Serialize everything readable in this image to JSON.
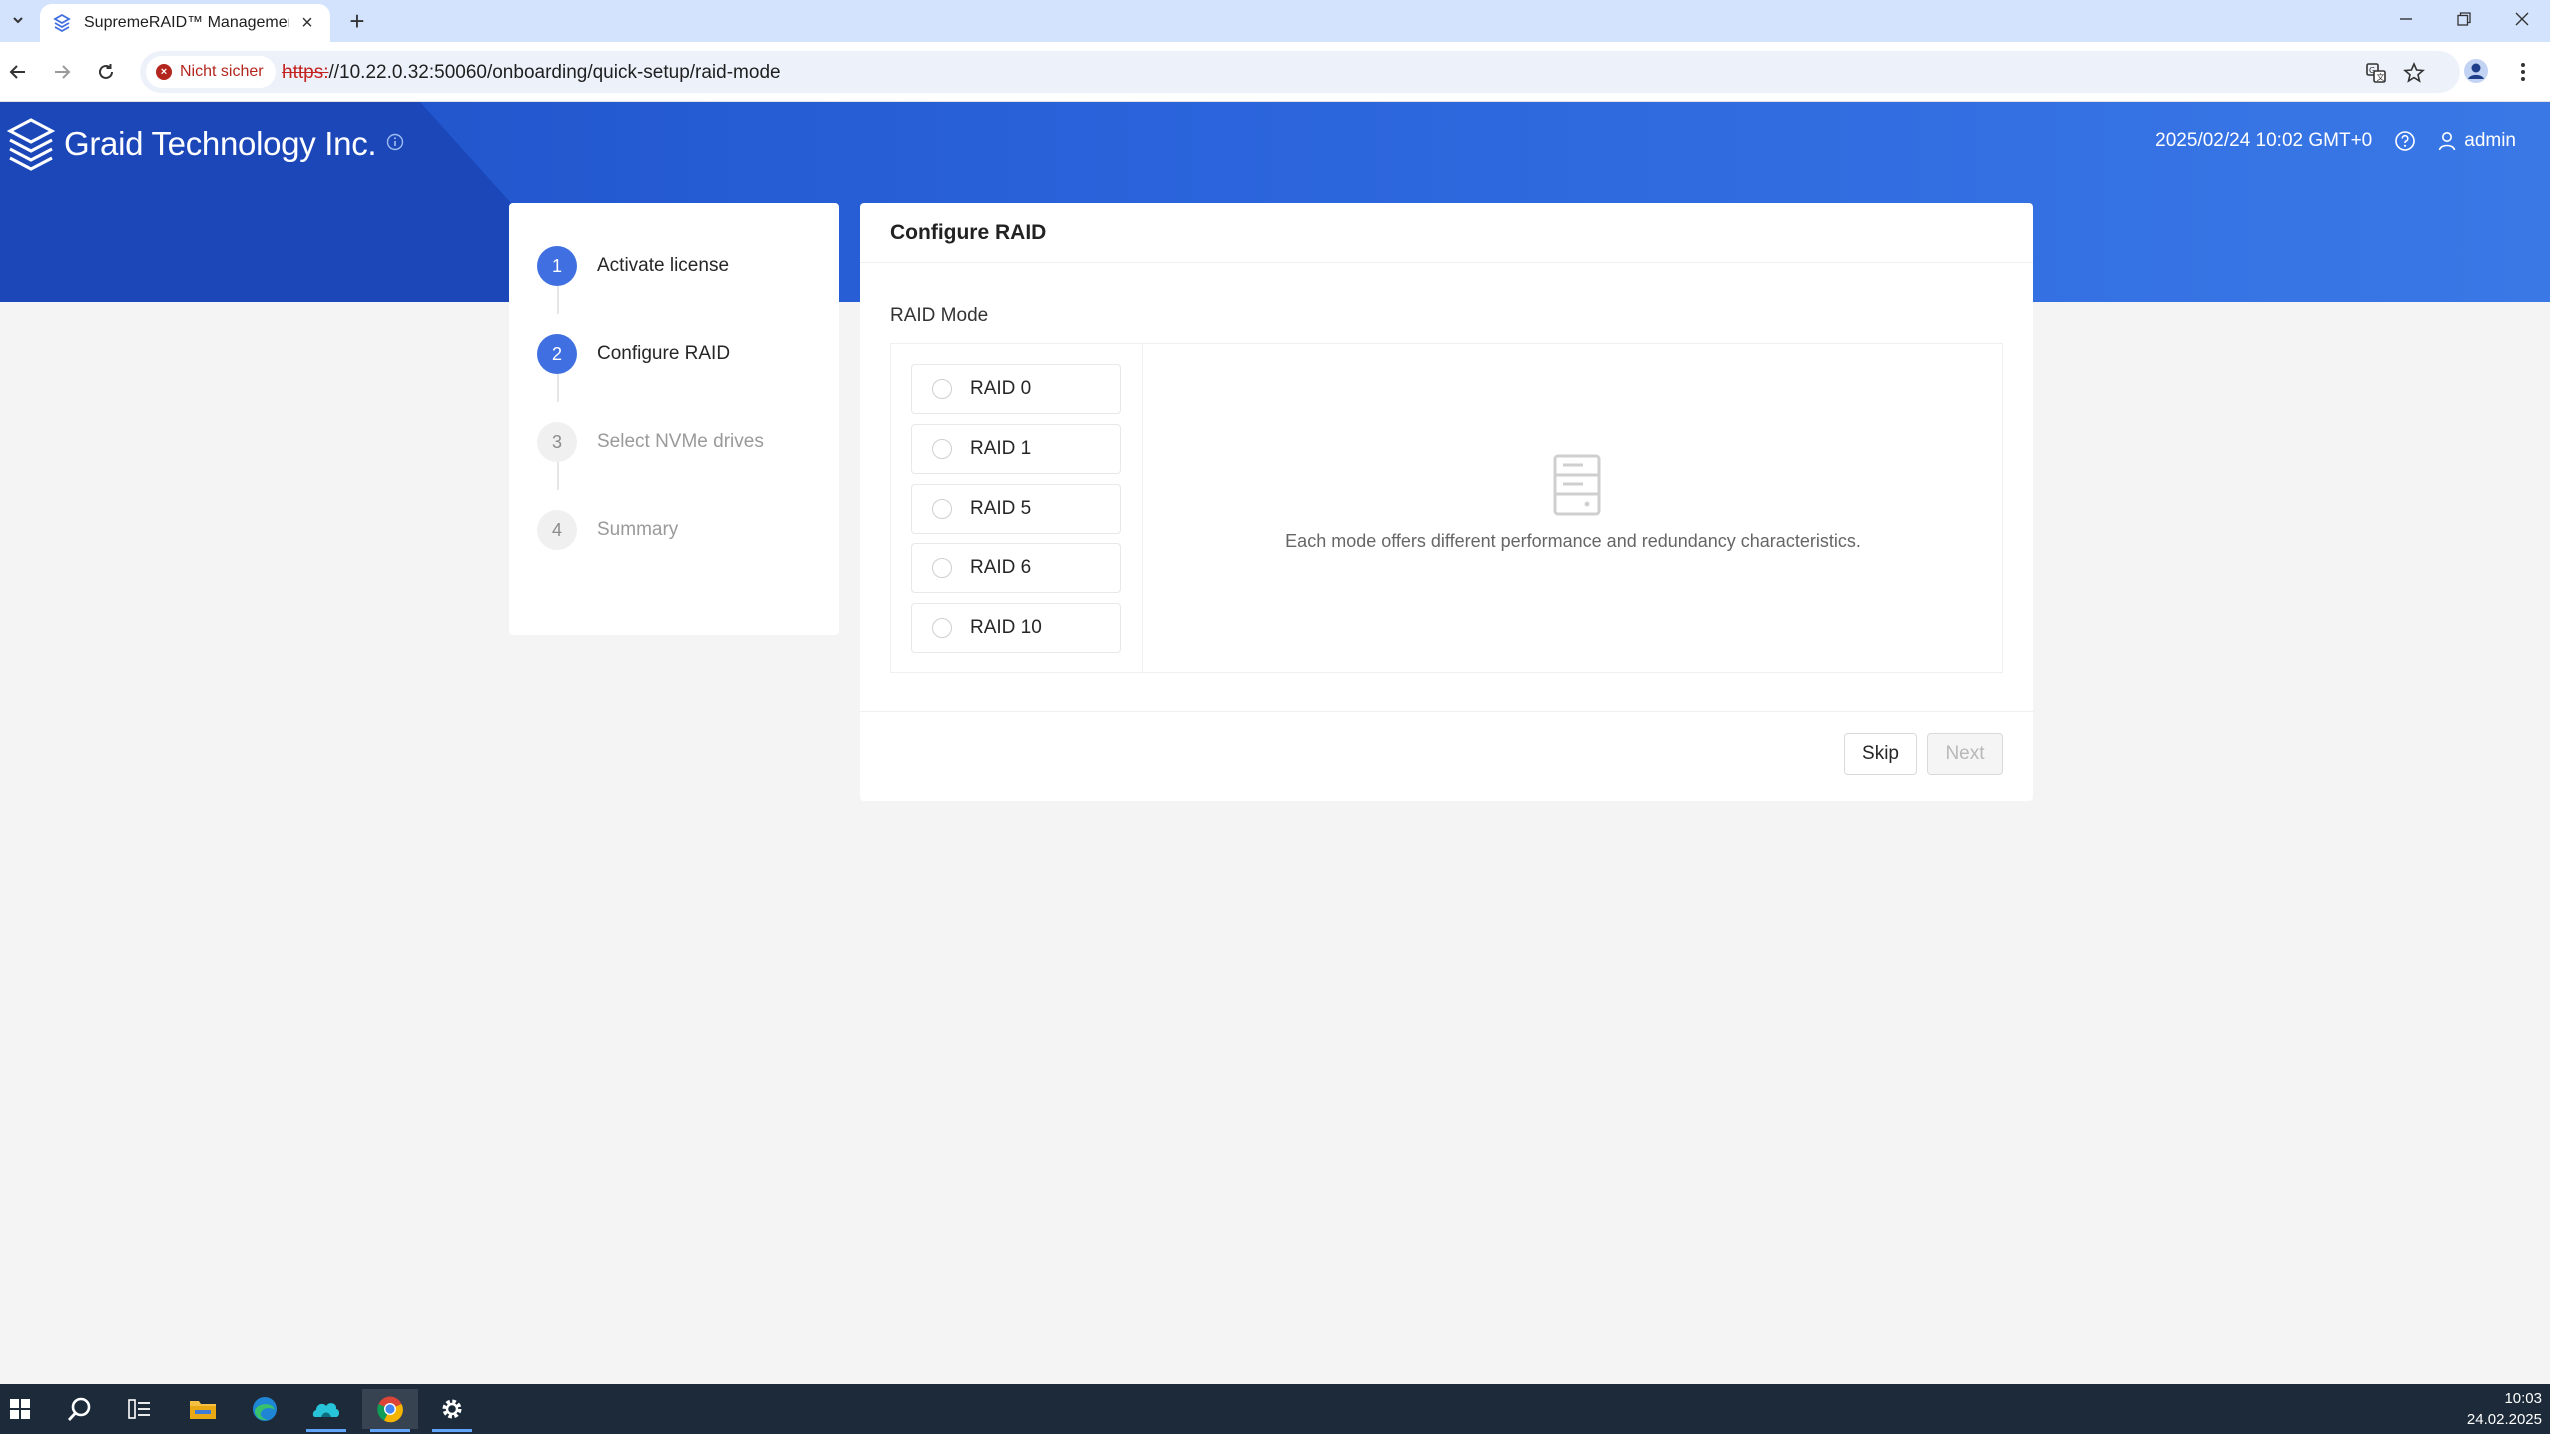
{
  "browser": {
    "tab_title": "SupremeRAID™ Management C",
    "security_label": "Nicht sicher",
    "url_scheme": "https:",
    "url_rest": "//10.22.0.32:50060/onboarding/quick-setup/raid-mode"
  },
  "header": {
    "brand": "Graid Technology Inc.",
    "datetime": "2025/02/24 10:02 GMT+0",
    "user": "admin"
  },
  "steps": [
    {
      "num": "1",
      "label": "Activate license"
    },
    {
      "num": "2",
      "label": "Configure RAID"
    },
    {
      "num": "3",
      "label": "Select NVMe drives"
    },
    {
      "num": "4",
      "label": "Summary"
    }
  ],
  "main": {
    "title": "Configure RAID",
    "raid_mode_label": "RAID Mode",
    "options": [
      "RAID 0",
      "RAID 1",
      "RAID 5",
      "RAID 6",
      "RAID 10"
    ],
    "description": "Each mode offers different performance and redundancy characteristics.",
    "skip_label": "Skip",
    "next_label": "Next"
  },
  "taskbar": {
    "time": "10:03",
    "date": "24.02.2025"
  },
  "colors": {
    "primary": "#3f6fe0",
    "header_blue": "#2a63db"
  }
}
